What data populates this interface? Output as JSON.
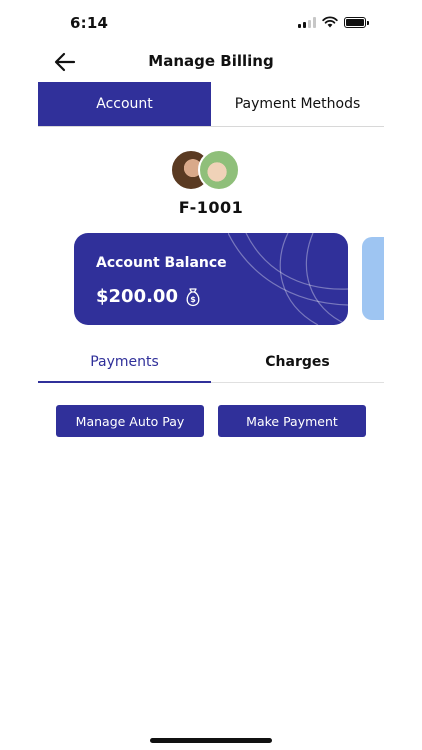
{
  "status_bar": {
    "time": "6:14"
  },
  "header": {
    "title": "Manage Billing",
    "back_icon": "arrow-left-icon"
  },
  "top_tabs": [
    {
      "label": "Account",
      "active": true
    },
    {
      "label": "Payment Methods",
      "active": false
    }
  ],
  "family": {
    "id": "F-1001"
  },
  "balance_card": {
    "label": "Account Balance",
    "amount": "$200.00",
    "icon": "money-bag-icon"
  },
  "sub_tabs": [
    {
      "label": "Payments",
      "active": true
    },
    {
      "label": "Charges",
      "active": false
    }
  ],
  "actions": {
    "auto_pay": "Manage Auto Pay",
    "make_payment": "Make Payment"
  },
  "colors": {
    "primary": "#30309a",
    "peek_card": "#9ec5f2"
  }
}
